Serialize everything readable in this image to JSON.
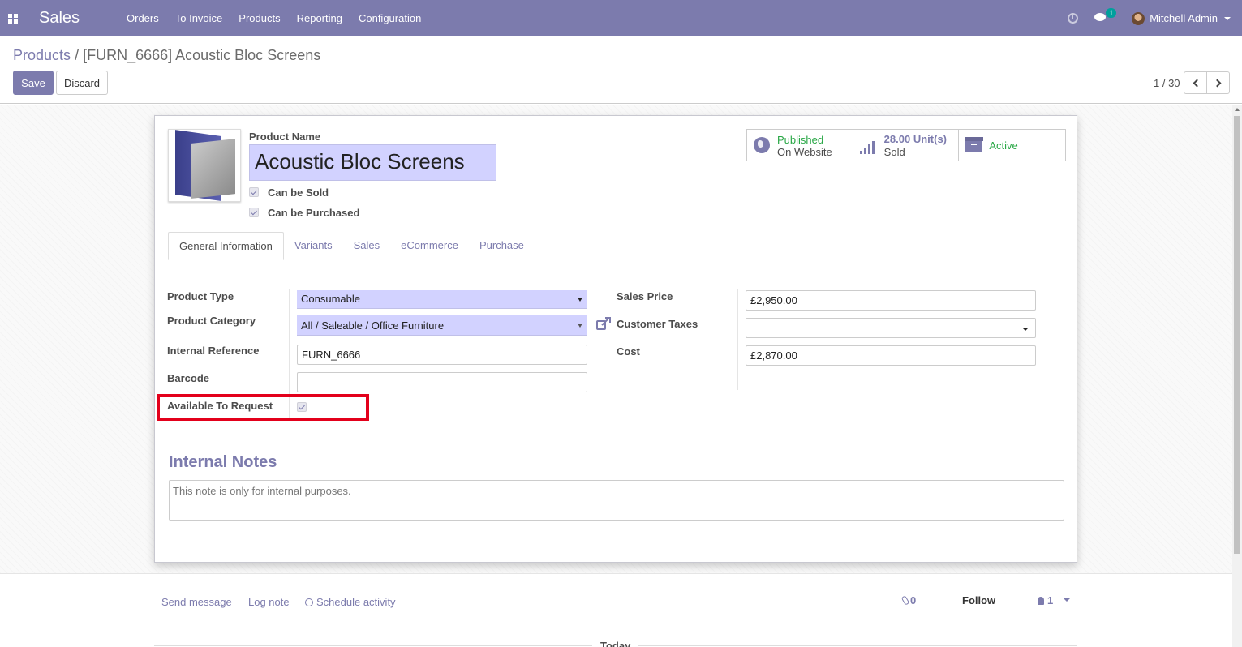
{
  "navbar": {
    "app_name": "Sales",
    "menu": [
      "Orders",
      "To Invoice",
      "Products",
      "Reporting",
      "Configuration"
    ],
    "chat_badge": "1",
    "user_name": "Mitchell Admin",
    "bg_color": "#7c7bad"
  },
  "breadcrumb": {
    "parent": "Products",
    "separator": "/",
    "current": "[FURN_6666] Acoustic Bloc Screens"
  },
  "toolbar": {
    "save_label": "Save",
    "discard_label": "Discard",
    "pager": "1 / 30"
  },
  "product": {
    "name_label": "Product Name",
    "name": "Acoustic Bloc Screens",
    "can_be_sold_label": "Can be Sold",
    "can_be_purchased_label": "Can be Purchased"
  },
  "smart_buttons": {
    "published_line1": "Published",
    "published_line2": "On Website",
    "sold_value": "28.00",
    "sold_unit": "Unit(s)",
    "sold_label": "Sold",
    "active_label": "Active"
  },
  "tabs": [
    "General Information",
    "Variants",
    "Sales",
    "eCommerce",
    "Purchase"
  ],
  "general": {
    "product_type_label": "Product Type",
    "product_type": "Consumable",
    "product_category_label": "Product Category",
    "product_category": "All / Saleable / Office Furniture",
    "internal_reference_label": "Internal Reference",
    "internal_reference": "FURN_6666",
    "barcode_label": "Barcode",
    "barcode": "",
    "available_to_request_label": "Available To Request",
    "sales_price_label": "Sales Price",
    "sales_price": "£2,950.00",
    "customer_taxes_label": "Customer Taxes",
    "customer_taxes": "",
    "cost_label": "Cost",
    "cost": "£2,870.00"
  },
  "notes": {
    "title": "Internal Notes",
    "placeholder": "This note is only for internal purposes."
  },
  "chatter": {
    "send_message": "Send message",
    "log_note": "Log note",
    "schedule_activity": "Schedule activity",
    "attachments_count": "0",
    "follow_label": "Follow",
    "followers_count": "1",
    "today_label": "Today"
  }
}
